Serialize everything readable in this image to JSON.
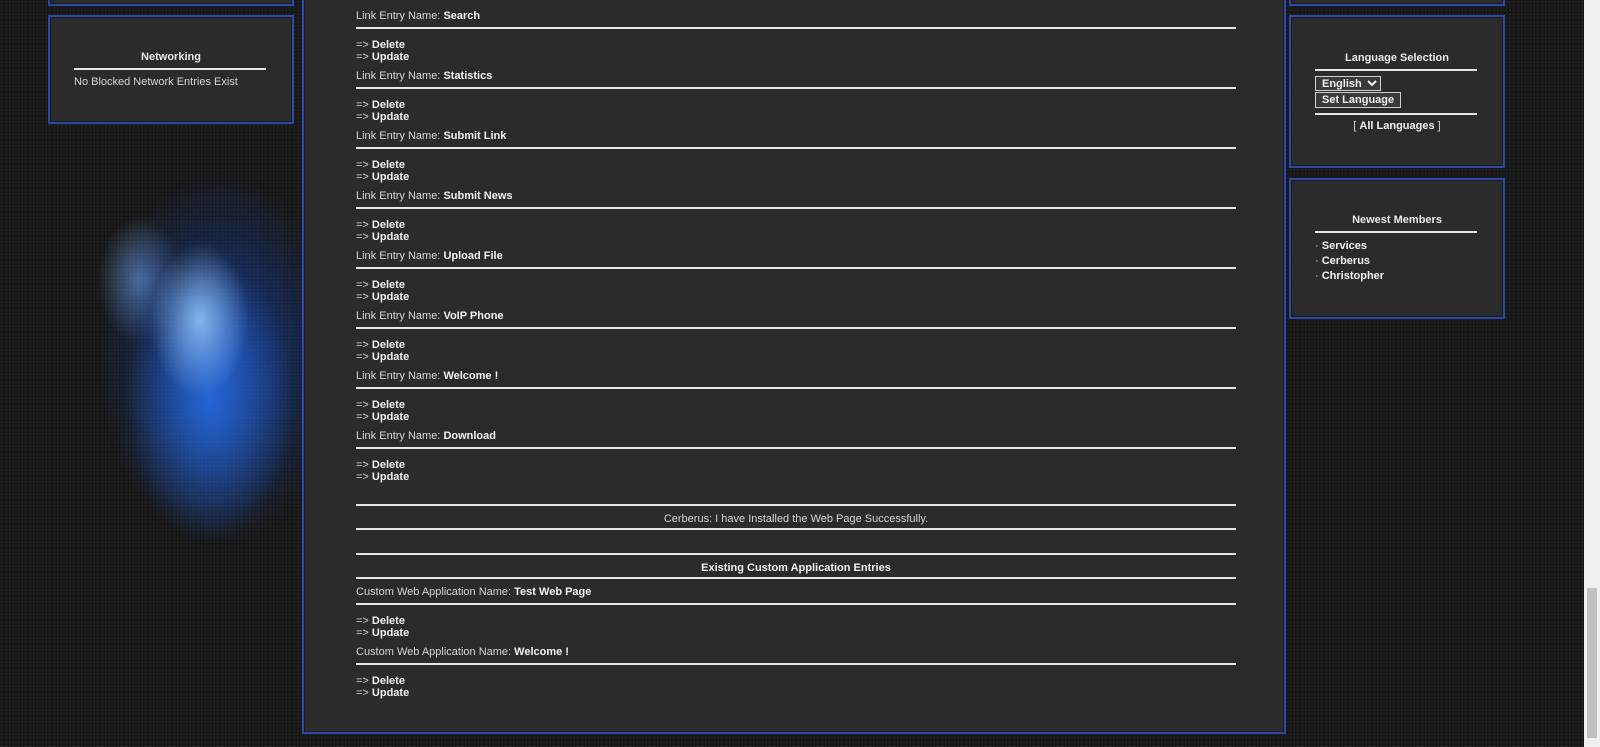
{
  "networking": {
    "title": "Networking",
    "empty_text": "No Blocked Network Entries Exist"
  },
  "language": {
    "title": "Language Selection",
    "selected": "English",
    "set_button": "Set Language",
    "bracket_open": "[",
    "all_languages": "All Languages",
    "bracket_close": "]"
  },
  "members": {
    "title": "Newest Members",
    "bullet": "·",
    "items": [
      "Services",
      "Cerberus",
      "Christopher"
    ]
  },
  "main": {
    "link_label": "Link Entry Name:",
    "arrow": "=>",
    "delete_label": "Delete",
    "update_label": "Update",
    "link_entries": [
      "Search",
      "Statistics",
      "Submit Link",
      "Submit News",
      "Upload File",
      "VoIP Phone",
      "Welcome !",
      "Download"
    ],
    "status_message": "Cerberus: I have Installed the Web Page Successfully.",
    "custom_heading": "Existing Custom Application Entries",
    "custom_label": "Custom Web Application Name:",
    "custom_entries": [
      "Test Web Page",
      "Welcome !"
    ]
  },
  "colors": {
    "panel_border": "#2c48a8",
    "panel_bg": "#2b2b2b",
    "page_bg": "#1b1b1b"
  }
}
